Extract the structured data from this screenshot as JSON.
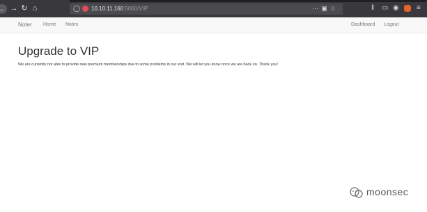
{
  "browser": {
    "url_host": "10.10.11.160",
    "url_path": ":5000/VIP",
    "icons": {
      "back": "back-arrow-icon",
      "forward": "forward-arrow-icon",
      "reload": "reload-icon",
      "home": "home-icon",
      "shield": "shield-icon",
      "warning": "insecure-connection-icon",
      "more": "ellipsis-icon",
      "pocket": "pocket-icon",
      "bookmark": "bookmark-star-icon",
      "library": "library-icon",
      "sidebar": "sidebar-icon",
      "account": "account-icon",
      "extension": "extension-icon",
      "menu": "hamburger-menu-icon"
    }
  },
  "navbar": {
    "brand": "Noter",
    "links": [
      "Home",
      "Notes"
    ],
    "right_links": [
      "Dashboard",
      "Logout"
    ]
  },
  "main": {
    "title": "Upgrade to VIP",
    "message": "We are currently not able to provide new premium memberships due to some problems in our end. We will let you know once we are back on. Thank you!"
  },
  "watermark": {
    "text": "moonsec"
  }
}
